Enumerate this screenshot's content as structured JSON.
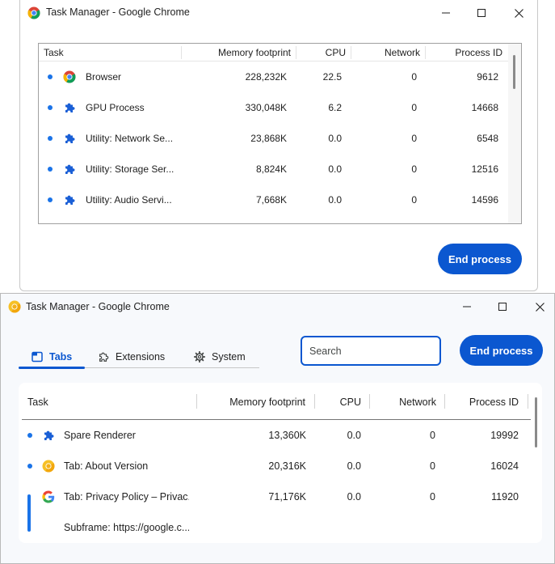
{
  "window1": {
    "title": "Task Manager - Google Chrome",
    "columns": [
      "Task",
      "Memory footprint",
      "CPU",
      "Network",
      "Process ID"
    ],
    "rows": [
      {
        "task": "Browser",
        "icon": "chrome-icon",
        "memory": "228,232K",
        "cpu": "22.5",
        "network": "0",
        "pid": "9612"
      },
      {
        "task": "GPU Process",
        "icon": "puzzle-piece-icon",
        "memory": "330,048K",
        "cpu": "6.2",
        "network": "0",
        "pid": "14668"
      },
      {
        "task": "Utility: Network Se...",
        "icon": "puzzle-piece-icon",
        "memory": "23,868K",
        "cpu": "0.0",
        "network": "0",
        "pid": "6548"
      },
      {
        "task": "Utility: Storage Ser...",
        "icon": "puzzle-piece-icon",
        "memory": "8,824K",
        "cpu": "0.0",
        "network": "0",
        "pid": "12516"
      },
      {
        "task": "Utility: Audio Servi...",
        "icon": "puzzle-piece-icon",
        "memory": "7,668K",
        "cpu": "0.0",
        "network": "0",
        "pid": "14596"
      }
    ],
    "end_process_label": "End process"
  },
  "window2": {
    "title": "Task Manager - Google Chrome",
    "tabs": [
      {
        "label": "Tabs",
        "icon": "tab-icon",
        "active": true
      },
      {
        "label": "Extensions",
        "icon": "extension-icon",
        "active": false
      },
      {
        "label": "System",
        "icon": "gear-icon",
        "active": false
      }
    ],
    "search": {
      "placeholder": "Search",
      "value": ""
    },
    "end_process_label": "End process",
    "columns": [
      "Task",
      "Memory footprint",
      "CPU",
      "Network",
      "Process ID"
    ],
    "rows": [
      {
        "task": "Spare Renderer",
        "icon": "puzzle-piece-icon",
        "memory": "13,360K",
        "cpu": "0.0",
        "network": "0",
        "pid": "19992"
      },
      {
        "task": "Tab: About Version",
        "icon": "chrome-yellow-icon",
        "memory": "20,316K",
        "cpu": "0.0",
        "network": "0",
        "pid": "16024"
      },
      {
        "task": "Tab: Privacy Policy – Privac...",
        "icon": "google-g-icon",
        "memory": "71,176K",
        "cpu": "0.0",
        "network": "0",
        "pid": "11920"
      },
      {
        "task": "Subframe: https://google.c...",
        "icon": "",
        "memory": "",
        "cpu": "",
        "network": "",
        "pid": ""
      }
    ]
  },
  "colors": {
    "accent": "#0b57d0",
    "bullet": "#1a73e8"
  }
}
